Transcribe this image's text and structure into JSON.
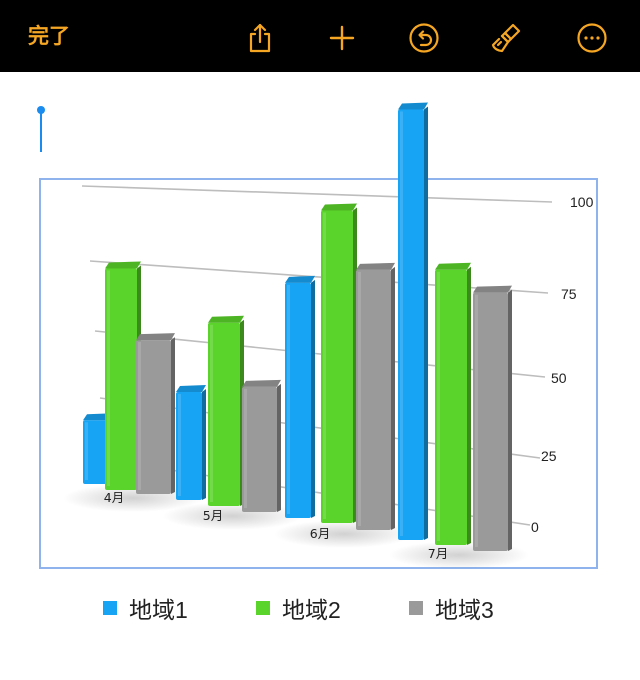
{
  "toolbar": {
    "done_label": "完了",
    "icons": [
      "share-icon",
      "add-icon",
      "undo-icon",
      "format-brush-icon",
      "more-icon"
    ],
    "accent_color": "#f5a623",
    "background": "#000000"
  },
  "chart_data": {
    "type": "bar",
    "style": "3d-perspective",
    "categories": [
      "4月",
      "5月",
      "6月",
      "7月"
    ],
    "series": [
      {
        "name": "地域1",
        "color": "#18a4f4",
        "values": [
          17,
          26.5,
          53,
          90
        ]
      },
      {
        "name": "地域2",
        "color": "#5ad42a",
        "values": [
          55.5,
          44,
          70,
          58
        ]
      },
      {
        "name": "地域3",
        "color": "#9a9a9a",
        "values": [
          39,
          30.5,
          58.5,
          54.5
        ]
      }
    ],
    "yticks": [
      "100",
      "75",
      "50",
      "25",
      "0"
    ],
    "ylim": [
      0,
      100
    ],
    "grid": true,
    "legend": "bottom"
  }
}
